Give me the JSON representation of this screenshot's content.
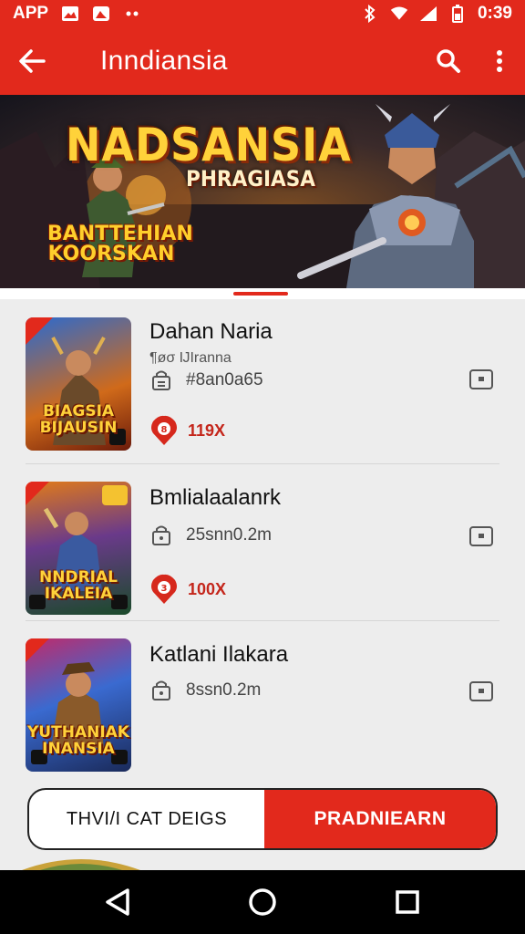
{
  "status_bar": {
    "app_label": "APP",
    "time": "0:39"
  },
  "app_bar": {
    "title": "Inndiansia"
  },
  "banner": {
    "title": "NADSANSIA",
    "subtitle": "PHRAGIASA",
    "badge_line1": "BANTTEHIAN",
    "badge_line2": "KOORSKAN"
  },
  "games": [
    {
      "title": "Dahan Naria",
      "subtitle": "¶øσ    ĲIranna",
      "meta": "#8an0a65",
      "rating": "119X",
      "thumb_line1": "BIAGSIA",
      "thumb_line2": "BIJAUSIN"
    },
    {
      "title": "Bmlialaalanrk",
      "meta": "25snn0.2m",
      "rating": "100X",
      "thumb_line1": "NNDRIAL",
      "thumb_line2": "IKALEIA"
    },
    {
      "title": "Katlani Ilakara",
      "meta": "8ssn0.2m",
      "thumb_line1": "YUTHANIAK",
      "thumb_line2": "INANSIA"
    }
  ],
  "toggle": {
    "left_label": "THVI/I CAT DEIGS",
    "right_label": "PRADNIEARN"
  },
  "colors": {
    "accent": "#e2291c",
    "background": "#ededed",
    "nav": "#000000"
  }
}
